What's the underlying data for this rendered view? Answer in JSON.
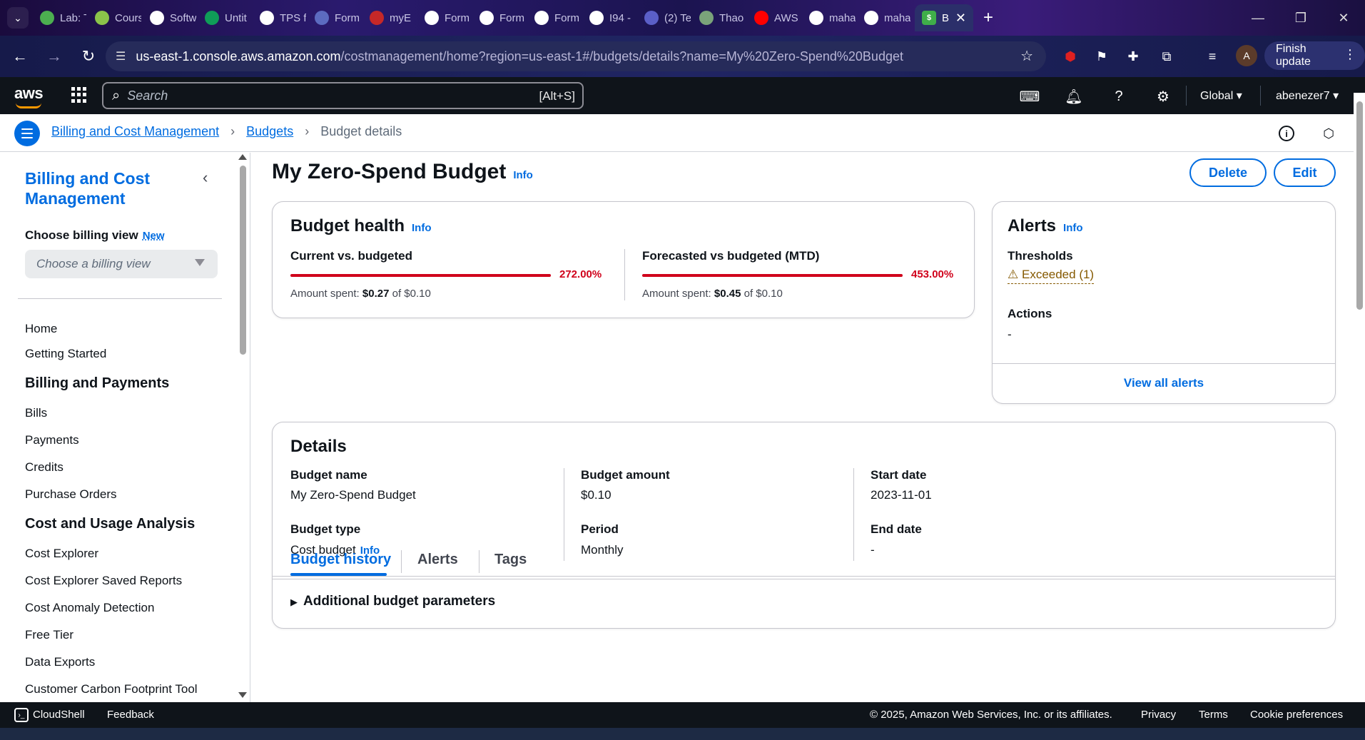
{
  "browser": {
    "tabs": [
      {
        "title": "Lab: T",
        "color": "#4caf50"
      },
      {
        "title": "Cours",
        "color": "#8bc34a"
      },
      {
        "title": "Softw",
        "color": "#ffffff"
      },
      {
        "title": "Untit",
        "color": "#0f9d58"
      },
      {
        "title": "TPS f",
        "color": "#ffffff"
      },
      {
        "title": "Form",
        "color": "#5c6bc0"
      },
      {
        "title": "myE",
        "color": "#c62828"
      },
      {
        "title": "Form",
        "color": "#ffffff"
      },
      {
        "title": "Form",
        "color": "#ffffff"
      },
      {
        "title": "Form",
        "color": "#ffffff"
      },
      {
        "title": "I94 -",
        "color": "#ffffff"
      },
      {
        "title": "(2) Te",
        "color": "#5b5fc7"
      },
      {
        "title": "Thao",
        "color": "#7aa37a"
      },
      {
        "title": "AWS",
        "color": "#ff0000"
      },
      {
        "title": "maha",
        "color": "#ffffff"
      },
      {
        "title": "maha",
        "color": "#ffffff"
      }
    ],
    "active_tab_title": "B",
    "url_host": "us-east-1.console.aws.amazon.com",
    "url_path": "/costmanagement/home?region=us-east-1#/budgets/details?name=My%20Zero-Spend%20Budget",
    "profile_initial": "A",
    "finish_update": "Finish update"
  },
  "aws_nav": {
    "logo": "aws",
    "search_placeholder": "Search",
    "search_shortcut": "[Alt+S]",
    "region": "Global ▾",
    "user": "abenezer7 ▾"
  },
  "breadcrumb": {
    "items": [
      "Billing and Cost Management",
      "Budgets"
    ],
    "current": "Budget details"
  },
  "sidebar": {
    "title": "Billing and Cost Management",
    "billing_view_label": "Choose billing view",
    "billing_view_badge": "New",
    "billing_view_placeholder": "Choose a billing view",
    "items_top": [
      "Home",
      "Getting Started"
    ],
    "section_billing": "Billing and Payments",
    "items_billing": [
      "Bills",
      "Payments",
      "Credits",
      "Purchase Orders"
    ],
    "section_cost": "Cost and Usage Analysis",
    "items_cost": [
      "Cost Explorer",
      "Cost Explorer Saved Reports",
      "Cost Anomaly Detection",
      "Free Tier",
      "Data Exports",
      "Customer Carbon Footprint Tool"
    ]
  },
  "page": {
    "title": "My Zero-Spend Budget",
    "info": "Info",
    "delete_label": "Delete",
    "edit_label": "Edit"
  },
  "budget_health": {
    "title": "Budget health",
    "info": "Info",
    "current": {
      "label": "Current vs. budgeted",
      "percent_text": "272.00%",
      "fill_fraction": 1.0,
      "amount_prefix": "Amount spent:",
      "amount_spent": "$0.27",
      "amount_of": "of $0.10"
    },
    "forecast": {
      "label": "Forecasted vs budgeted (MTD)",
      "percent_text": "453.00%",
      "fill_fraction": 1.0,
      "amount_prefix": "Amount spent:",
      "amount_spent": "$0.45",
      "amount_of": "of $0.10"
    }
  },
  "alerts_card": {
    "title": "Alerts",
    "info": "Info",
    "thresholds_label": "Thresholds",
    "thresholds_value": "Exceeded (1)",
    "actions_label": "Actions",
    "actions_value": "-",
    "view_all": "View all alerts"
  },
  "details": {
    "title": "Details",
    "budget_name_label": "Budget name",
    "budget_name": "My Zero-Spend Budget",
    "budget_type_label": "Budget type",
    "budget_type": "Cost budget",
    "budget_type_info": "Info",
    "budget_amount_label": "Budget amount",
    "budget_amount": "$0.10",
    "period_label": "Period",
    "period": "Monthly",
    "start_date_label": "Start date",
    "start_date": "2023-11-01",
    "end_date_label": "End date",
    "end_date": "-",
    "additional_params": "Additional budget parameters"
  },
  "tabs": [
    "Budget history",
    "Alerts",
    "Tags"
  ],
  "footer": {
    "cloudshell": "CloudShell",
    "feedback": "Feedback",
    "copyright": "© 2025, Amazon Web Services, Inc. or its affiliates.",
    "privacy": "Privacy",
    "terms": "Terms",
    "cookie": "Cookie preferences"
  },
  "colors": {
    "link": "#006ce0",
    "error": "#d0021b",
    "warning": "#855900",
    "nav_bg": "#0f141a"
  }
}
